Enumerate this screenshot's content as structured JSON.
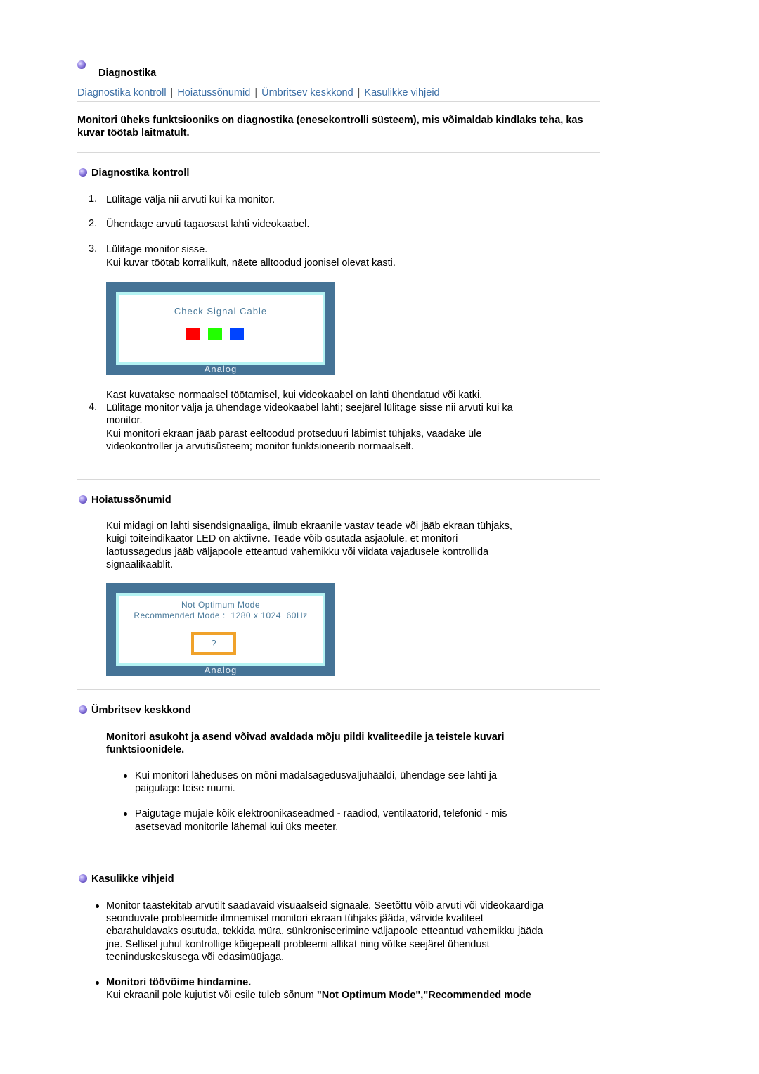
{
  "header": {
    "title": "Diagnostika",
    "nav": [
      "Diagnostika kontroll",
      "Hoiatussõnumid",
      "Ümbritsev keskkond",
      "Kasulikke vihjeid"
    ],
    "nav_separator": "|"
  },
  "intro": "Monitori üheks funktsiooniks on diagnostika (enesekontrolli süsteem), mis võimaldab kindlaks teha, kas kuvar töötab laitmatult.",
  "sections": {
    "diagnostika": {
      "heading": "Diagnostika kontroll",
      "steps": [
        {
          "num": "1.",
          "text": "Lülitage välja nii arvuti kui ka monitor."
        },
        {
          "num": "2.",
          "text": "Ühendage arvuti tagaosast lahti videokaabel."
        },
        {
          "num": "3.",
          "text": "Lülitage monitor sisse.",
          "extra": "Kui kuvar töötab korralikult, näete alltoodud joonisel olevat kasti."
        }
      ],
      "osd": {
        "message": "Check Signal Cable",
        "footer": "Analog",
        "squares": [
          "#ff0000",
          "#22ff00",
          "#0044ff"
        ]
      },
      "after_image": "Kast kuvatakse normaalsel töötamisel, kui videokaabel on lahti ühendatud või katki.",
      "step4": {
        "num": "4.",
        "text_line1": "Lülitage monitor välja ja ühendage videokaabel lahti; seejärel lülitage sisse nii arvuti kui ka",
        "text_line2": "monitor.",
        "extra_line1": "Kui monitori ekraan jääb pärast eeltoodud protseduuri läbimist tühjaks, vaadake üle",
        "extra_line2": "videokontroller ja arvutisüsteem; monitor funktsioneerib normaalselt."
      }
    },
    "hoiatus": {
      "heading": "Hoiatussõnumid",
      "lines": [
        "Kui midagi on lahti sisendsignaaliga, ilmub ekraanile vastav teade või jääb ekraan tühjaks,",
        "kuigi toiteindikaator LED on aktiivne. Teade võib osutada asjaolule, et monitori",
        "laotussagedus jääb väljapoole etteantud vahemikku või viidata vajadusele kontrollida",
        "signaalikaablit."
      ],
      "osd": {
        "line1": "Not Optimum Mode",
        "line2": "Recommended Mode :  1280 x 1024  60Hz",
        "button": "?",
        "footer": "Analog",
        "accent": "#f0a22a"
      }
    },
    "keskkond": {
      "heading": "Ümbritsev keskkond",
      "lead_line1": "Monitori asukoht ja asend võivad avaldada mõju pildi kvaliteedile ja teistele kuvari",
      "lead_line2": "funktsioonidele.",
      "bullets": [
        {
          "line1": "Kui monitori läheduses on mõni madalsagedusvaljuhääldi, ühendage see lahti ja",
          "line2": "paigutage teise ruumi."
        },
        {
          "line1": "Paigutage mujale kõik elektroonikaseadmed - raadiod, ventilaatorid, telefonid - mis",
          "line2": "asetsevad monitorile lähemal kui üks meeter."
        }
      ]
    },
    "vihjeid": {
      "heading": "Kasulikke vihjeid",
      "bullet1_lines": [
        "Monitor taastekitab arvutilt saadavaid visuaalseid signaale. Seetõttu võib arvuti või videokaardiga",
        "seonduvate probleemide ilmnemisel monitori ekraan tühjaks jääda, värvide kvaliteet",
        "ebarahuldavaks osutuda, tekkida müra, sünkroniseerimine väljapoole etteantud vahemikku jääda",
        "jne. Sellisel juhul kontrollige kõigepealt probleemi allikat ning võtke seejärel ühendust",
        "teeninduskeskusega või edasimüüjaga."
      ],
      "bullet2_title": "Monitori töövõime hindamine.",
      "bullet2_text": "Kui ekraanil pole kujutist või esile tuleb sõnum ",
      "bullet2_bold": "\"Not Optimum Mode\",\"Recommended mode"
    }
  }
}
